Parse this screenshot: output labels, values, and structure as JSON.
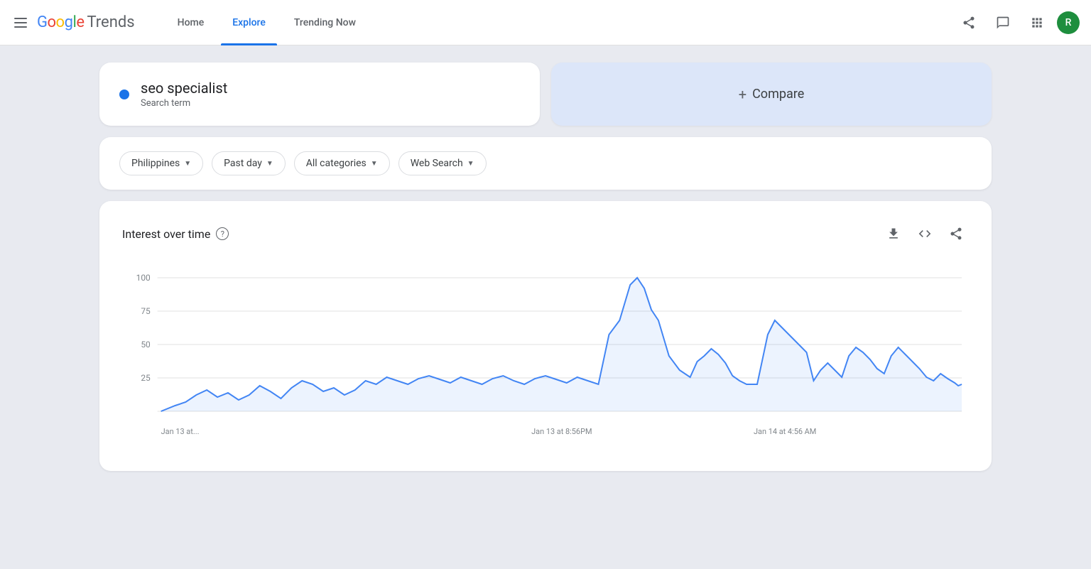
{
  "header": {
    "menu_label": "menu",
    "logo_google": "Google",
    "logo_trends": "Trends",
    "nav": [
      {
        "id": "home",
        "label": "Home",
        "active": false
      },
      {
        "id": "explore",
        "label": "Explore",
        "active": true
      },
      {
        "id": "trending",
        "label": "Trending Now",
        "active": false
      }
    ],
    "share_icon": "share",
    "messages_icon": "messages",
    "apps_icon": "apps",
    "avatar_letter": "R"
  },
  "search": {
    "term": "seo specialist",
    "type": "Search term",
    "compare_label": "Compare",
    "compare_plus": "+"
  },
  "filters": [
    {
      "id": "country",
      "label": "Philippines"
    },
    {
      "id": "time",
      "label": "Past day"
    },
    {
      "id": "category",
      "label": "All categories"
    },
    {
      "id": "search_type",
      "label": "Web Search"
    }
  ],
  "chart": {
    "title": "Interest over time",
    "help": "?",
    "download_icon": "download",
    "embed_icon": "embed",
    "share_icon": "share",
    "y_labels": [
      "100",
      "75",
      "50",
      "25"
    ],
    "x_labels": [
      "Jan 13 at...",
      "Jan 13 at 8:56PM",
      "Jan 14 at 4:56 AM"
    ],
    "accent_color": "#4285f4"
  },
  "colors": {
    "blue": "#1a73e8",
    "light_blue_bg": "#dce6f9",
    "page_bg": "#e8eaf0"
  }
}
